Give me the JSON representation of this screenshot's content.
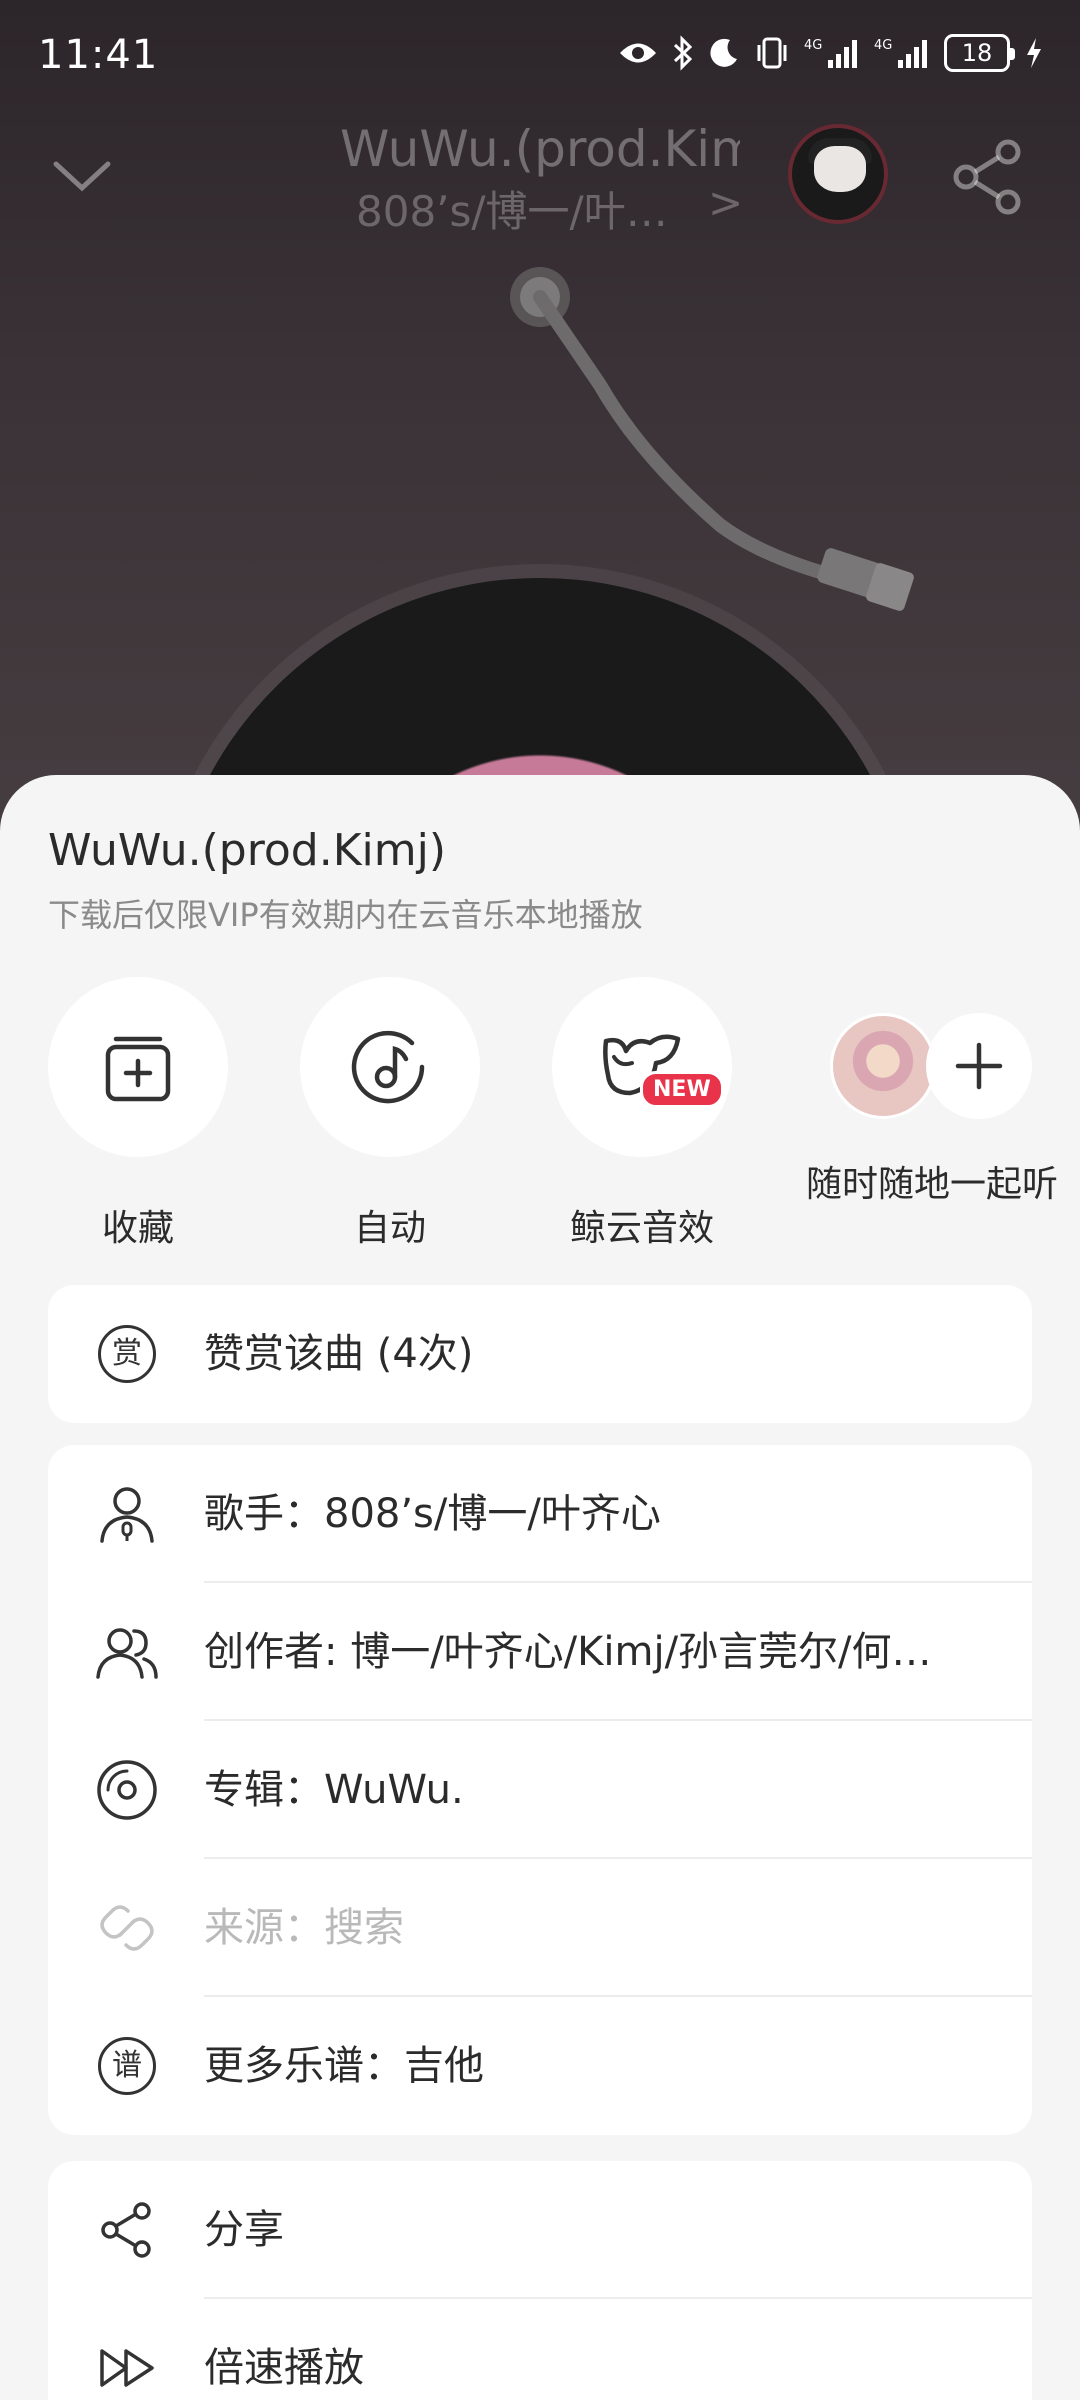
{
  "status_bar": {
    "time": "11:41",
    "battery": "18",
    "icons": [
      "eye-icon",
      "bluetooth-icon",
      "moon-icon",
      "vibrate-icon",
      "signal-4g-icon",
      "signal-4g-icon",
      "charging-icon"
    ]
  },
  "header": {
    "song_title": "WuWu.(prod.Kim",
    "artist": "808’s/博一/叶…",
    "artist_chevron": ">"
  },
  "sheet": {
    "title": "WuWu.(prod.Kimj)",
    "subtitle": "下载后仅限VIP有效期内在云音乐本地播放",
    "quick_actions": [
      {
        "label": "收藏",
        "icon": "collect-icon"
      },
      {
        "label": "自动",
        "icon": "auto-quality-icon"
      },
      {
        "label": "鲸云音效",
        "icon": "whale-sound-effect-icon",
        "badge": "NEW"
      },
      {
        "label": "随时随地一起听",
        "icon": "listen-together-icon"
      }
    ],
    "reward": {
      "label": "赞赏该曲 (4次)",
      "icon_glyph": "赏"
    },
    "info_rows": [
      {
        "label": "歌手：808’s/博一/叶齐心",
        "icon": "singer-icon"
      },
      {
        "label": "创作者: 博一/叶齐心/Kimj/孙言莞尔/何…",
        "icon": "creators-icon"
      },
      {
        "label": "专辑：WuWu.",
        "icon": "album-icon"
      },
      {
        "label": "来源：搜索",
        "icon": "link-icon"
      },
      {
        "label": "更多乐谱：吉他",
        "icon_glyph": "谱"
      }
    ],
    "action_rows": [
      {
        "label": "分享",
        "icon": "share-icon"
      },
      {
        "label": "倍速播放",
        "icon": "speed-icon"
      }
    ]
  },
  "colors": {
    "accent": "#e8334a",
    "sheet_bg": "#f5f5f5"
  }
}
